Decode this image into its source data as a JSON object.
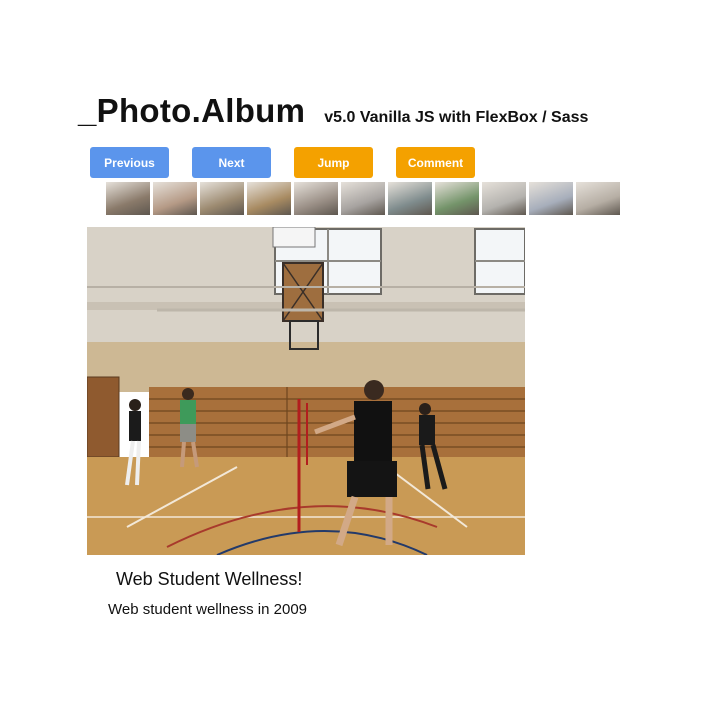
{
  "header": {
    "title": "_Photo.Album",
    "subtitle": "v5.0 Vanilla JS with FlexBox / Sass"
  },
  "buttons": [
    {
      "label": "Previous",
      "color": "#5b95ec"
    },
    {
      "label": "Next",
      "color": "#5b95ec"
    },
    {
      "label": "Jump",
      "color": "#f4a100"
    },
    {
      "label": "Comment",
      "color": "#f4a100"
    }
  ],
  "thumbnails": [
    {
      "name": "thumb-1",
      "tone": "#8a7a6a"
    },
    {
      "name": "thumb-2",
      "tone": "#b59a86"
    },
    {
      "name": "thumb-3",
      "tone": "#9c8a70"
    },
    {
      "name": "thumb-4",
      "tone": "#a88b62"
    },
    {
      "name": "thumb-5",
      "tone": "#9a8f86"
    },
    {
      "name": "thumb-6",
      "tone": "#a7a3a0"
    },
    {
      "name": "thumb-7",
      "tone": "#7f8c8d"
    },
    {
      "name": "thumb-8",
      "tone": "#74946a"
    },
    {
      "name": "thumb-9",
      "tone": "#b4b2ae"
    },
    {
      "name": "thumb-10",
      "tone": "#a7aebb"
    },
    {
      "name": "thumb-11",
      "tone": "#b6aea4"
    }
  ],
  "photo": {
    "caption_title": "Web Student Wellness!",
    "caption_desc": "Web student wellness in 2009"
  }
}
